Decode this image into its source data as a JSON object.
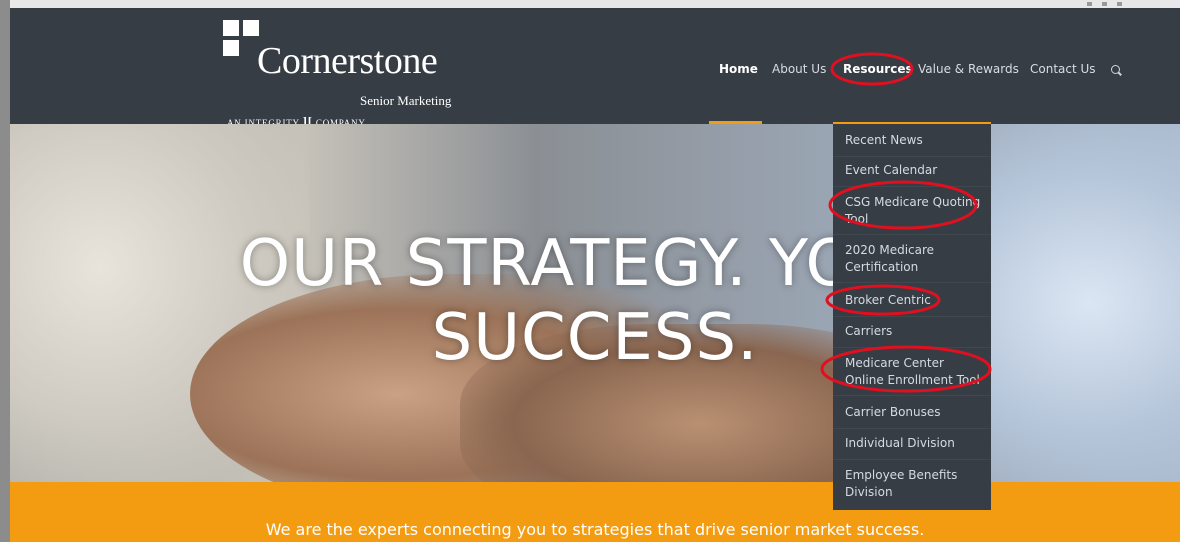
{
  "logo": {
    "wordmark": "Cornerstone",
    "subtitle": "Senior Marketing",
    "tagline_left": "AN INTEGRITY",
    "tagline_right": "COMPANY"
  },
  "nav": {
    "items": [
      {
        "label": "Home"
      },
      {
        "label": "About Us"
      },
      {
        "label": "Resources"
      },
      {
        "label": "Value & Rewards"
      },
      {
        "label": "Contact Us"
      }
    ],
    "active": "Home",
    "search_icon": "search-icon"
  },
  "dropdown": {
    "items": [
      {
        "label": "Recent News"
      },
      {
        "label": "Event Calendar"
      },
      {
        "label": "CSG Medicare Quoting Tool"
      },
      {
        "label": "2020 Medicare Certification"
      },
      {
        "label": "Broker Centric"
      },
      {
        "label": "Carriers"
      },
      {
        "label": "Medicare Center Online Enrollment Tool"
      },
      {
        "label": "Carrier Bonuses"
      },
      {
        "label": "Individual Division"
      },
      {
        "label": "Employee Benefits Division"
      }
    ]
  },
  "hero": {
    "line1": "OUR STRATEGY. YOUR",
    "line2": "SUCCESS."
  },
  "banner": {
    "text": "We are the experts connecting you to strategies that drive senior market success."
  },
  "colors": {
    "nav_bg": "#363d45",
    "accent": "#f39c12",
    "annotation": "#e01020"
  }
}
